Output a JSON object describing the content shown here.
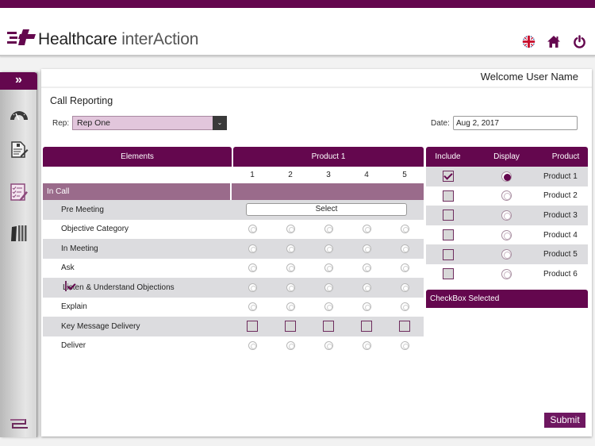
{
  "app": {
    "brand": "Healthcare",
    "brand_light": "interAction",
    "brand_color": "#64074e"
  },
  "header": {
    "icons": [
      "uk-flag-icon",
      "home-icon",
      "power-icon"
    ]
  },
  "sidebar": {
    "toggle_label": "»",
    "items": [
      {
        "name": "dashboard-gauge-icon"
      },
      {
        "name": "document-edit-icon"
      },
      {
        "name": "call-report-checklist-icon",
        "active": true
      },
      {
        "name": "library-books-icon"
      }
    ],
    "footer_icon": "menu-lines-icon"
  },
  "main": {
    "welcome": "Welcome User Name",
    "title": "Call Reporting",
    "rep_label": "Rep:",
    "rep_value": "Rep One",
    "date_label": "Date:",
    "date_value": "Aug 2, 2017",
    "grid": {
      "elements_header": "Elements",
      "product_header": "Product 1",
      "columns": [
        "1",
        "2",
        "3",
        "4",
        "5"
      ],
      "section": "In Call",
      "select_label": "Select",
      "rows": [
        {
          "label": "Pre Meeting",
          "type": "select"
        },
        {
          "label": "Objective Category",
          "type": "radio"
        },
        {
          "label": "In Meeting",
          "type": "radio"
        },
        {
          "label": "Ask",
          "type": "radio"
        },
        {
          "label": "Listen & Understand Objections",
          "type": "radio",
          "checked": true
        },
        {
          "label": "Explain",
          "type": "radio"
        },
        {
          "label": "Key Message Delivery",
          "type": "checkbox"
        },
        {
          "label": "Deliver",
          "type": "radio"
        }
      ]
    },
    "products": {
      "headers": [
        "Include",
        "Display",
        "Product"
      ],
      "rows": [
        {
          "name": "Product 1",
          "include": true,
          "display": true
        },
        {
          "name": "Product 2",
          "include": false,
          "display": false
        },
        {
          "name": "Product 3",
          "include": false,
          "display": false
        },
        {
          "name": "Product 4",
          "include": false,
          "display": false
        },
        {
          "name": "Product 5",
          "include": false,
          "display": false
        },
        {
          "name": "Product 6",
          "include": false,
          "display": false
        }
      ]
    },
    "checkbox_selected_label": "CheckBox Selected",
    "submit_label": "Submit"
  }
}
